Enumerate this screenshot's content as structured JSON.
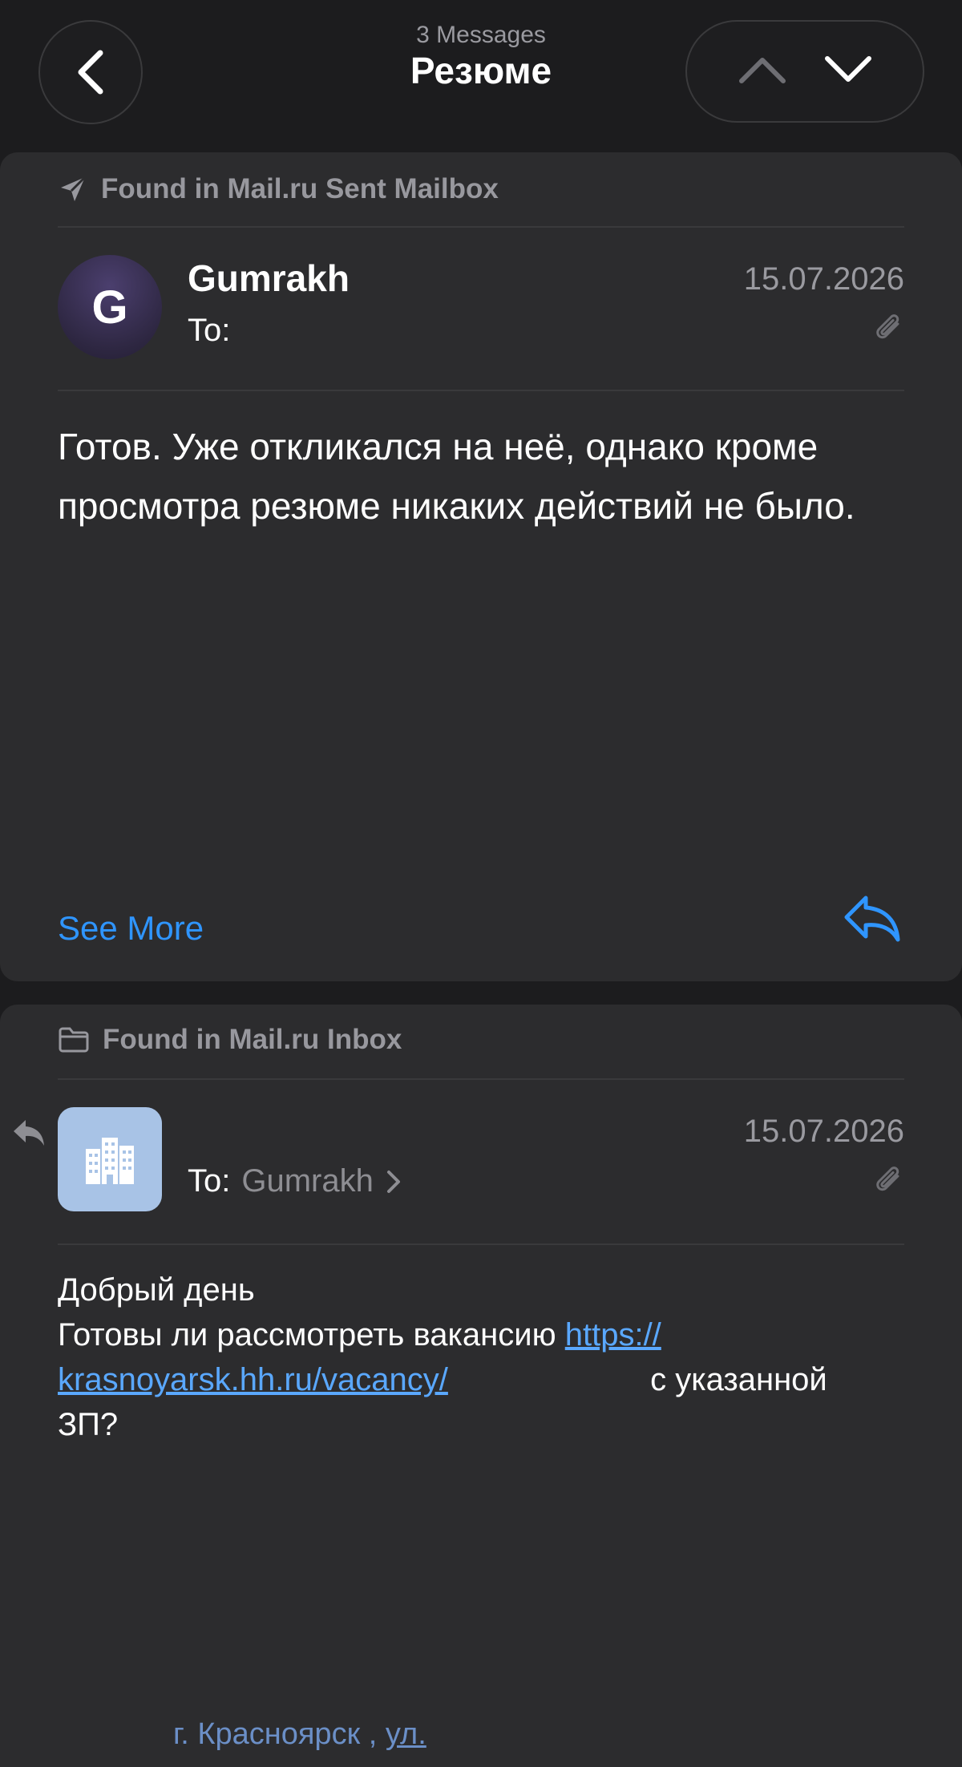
{
  "header": {
    "subtitle": "3 Messages",
    "title": "Резюме"
  },
  "message1": {
    "found_in": "Found in Mail.ru Sent Mailbox",
    "avatar_letter": "G",
    "sender": "Gumrakh",
    "to_label": "To:",
    "date": "15.07.2026",
    "body": "Готов. Уже откликался на неё, однако кроме просмотра резюме никаких действий не было.",
    "see_more": "See More"
  },
  "message2": {
    "found_in": "Found in Mail.ru Inbox",
    "to_label": "To:",
    "recipient": "Gumrakh",
    "date": "15.07.2026",
    "greeting": "Добрый день",
    "question_prefix": "Готовы ли рассмотреть вакансию",
    "link_part1": "https://",
    "link_part2": "krasnoyarsk.hh.ru/vacancy/",
    "question_suffix": "с указанной",
    "question_end": "ЗП?",
    "footer_city": "г. Красноярск ,",
    "footer_street": "ул."
  },
  "colors": {
    "background": "#1c1c1e",
    "card": "#2c2c2e",
    "accent": "#2f95ff",
    "link": "#5aa8ff",
    "muted": "#98989e"
  },
  "icons": [
    "chevron-left-icon",
    "chevron-up-icon",
    "chevron-down-icon",
    "paper-plane-icon",
    "paperclip-icon",
    "reply-icon",
    "folder-icon",
    "building-icon",
    "chevron-right-icon"
  ]
}
